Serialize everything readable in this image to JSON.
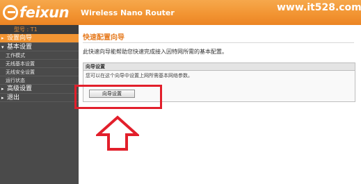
{
  "header": {
    "logo_text": "feixun",
    "product_name": "Wireless Nano Router",
    "watermark": "www.it528.com"
  },
  "sidebar": {
    "account": "型号 : T1",
    "items": [
      {
        "label": "设置向导",
        "active": true
      },
      {
        "label": "基本设置",
        "active": false
      },
      {
        "label": "工作模式",
        "sub": true
      },
      {
        "label": "无线基本设置",
        "sub": true
      },
      {
        "label": "无线安全设置",
        "sub": true
      },
      {
        "label": "运行状态",
        "sub": true
      },
      {
        "label": "高级设置",
        "active": false
      },
      {
        "label": "退出",
        "active": false
      }
    ]
  },
  "main": {
    "title": "快速配置向导",
    "subtitle": "此快速向导能帮助您快速完成接入因特网所需的基本配置。",
    "box_title": "向导设置",
    "box_desc": "您可以在这个向导中设置上网所需基本网络参数。",
    "wizard_button": "向导设置"
  },
  "colors": {
    "header": "#f29533",
    "accent": "#e67c21",
    "sidebar": "#4a4a4a",
    "highlight": "#e21f2b"
  },
  "icons": [
    "logo-mark-icon",
    "nav-arrow-icon",
    "up-arrow-icon"
  ]
}
